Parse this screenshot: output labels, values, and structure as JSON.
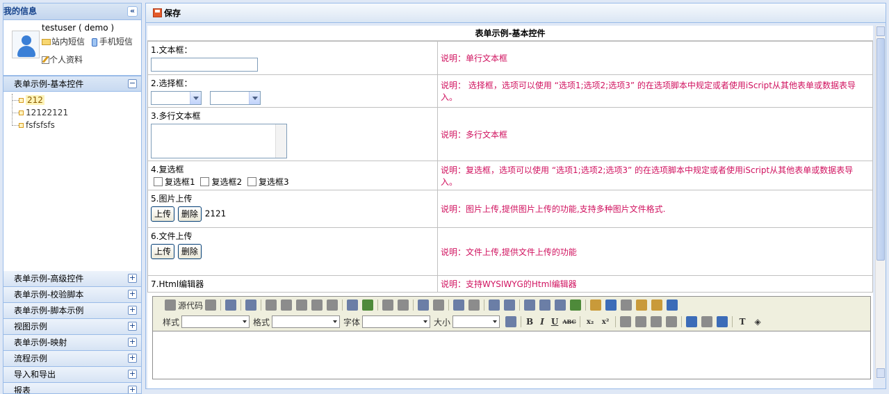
{
  "sidebar": {
    "title": "我的信息",
    "collapse_glyph": "«",
    "user": {
      "name": "testuser ( demo )",
      "link_site_msg": "站内短信",
      "link_sms": "手机短信",
      "link_profile": "个人资料"
    },
    "open_section": {
      "label": "表单示例-基本控件",
      "toggle": "−",
      "items": [
        "212",
        "12122121",
        "fsfsfsfs"
      ]
    },
    "sections": [
      {
        "label": "表单示例-高级控件",
        "toggle": "+"
      },
      {
        "label": "表单示例-校验脚本",
        "toggle": "+"
      },
      {
        "label": "表单示例-脚本示例",
        "toggle": "+"
      },
      {
        "label": "视图示例",
        "toggle": "+"
      },
      {
        "label": "表单示例-映射",
        "toggle": "+"
      },
      {
        "label": "流程示例",
        "toggle": "+"
      },
      {
        "label": "导入和导出",
        "toggle": "+"
      },
      {
        "label": "报表",
        "toggle": "+"
      }
    ]
  },
  "toolbar": {
    "save_label": "保存"
  },
  "form": {
    "title": "表单示例-基本控件",
    "rows": [
      {
        "label": "1.文本框：",
        "desc": "说明：单行文本框"
      },
      {
        "label": "2.选择框：",
        "desc": "说明： 选择框，选项可以使用 “选项1;选项2;选项3” 的在选项脚本中规定或者使用iScript从其他表单或数据表导入。"
      },
      {
        "label": "3.多行文本框",
        "desc": "说明：多行文本框"
      },
      {
        "label": "4.复选框",
        "desc": "说明：复选框，选项可以使用 “选项1;选项2;选项3” 的在选项脚本中规定或者使用iScript从其他表单或数据表导入。"
      },
      {
        "label": "5.图片上传",
        "desc": "说明：图片上传,提供图片上传的功能,支持多种图片文件格式."
      },
      {
        "label": "6.文件上传",
        "desc": "说明：文件上传,提供文件上传的功能"
      },
      {
        "label": "7.Html编辑器",
        "desc": "说明：支持WYSIWYG的Html编辑器"
      }
    ],
    "checkboxes": [
      "复选框1",
      "复选框2",
      "复选框3"
    ],
    "upload_label": "上传",
    "delete_label": "删除",
    "image_value": "2121"
  },
  "editor": {
    "source_label": "源代码",
    "style_label": "样式",
    "format_label": "格式",
    "font_label": "字体",
    "size_label": "大小",
    "bold": "B",
    "italic": "I",
    "underline": "U",
    "strike": "ABC",
    "sub": "x₂",
    "sup": "x²",
    "text_color_label": "T",
    "bg_color_label": "◈"
  }
}
